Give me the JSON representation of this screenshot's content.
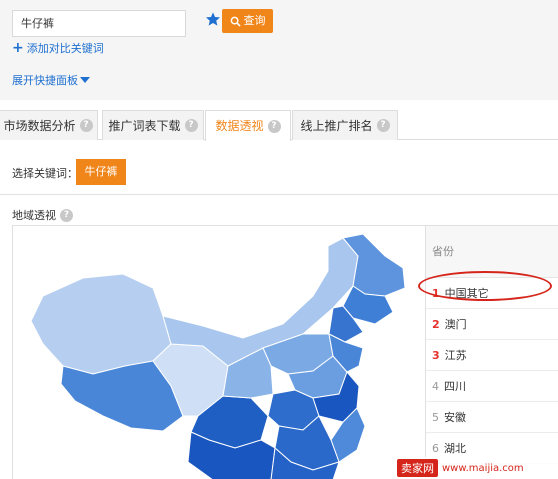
{
  "search": {
    "value": "牛仔裤"
  },
  "toolbar": {
    "query_label": "查询",
    "add_compare_label": "添加对比关键词",
    "expand_panel_label": "展开快捷面板"
  },
  "tabs": [
    {
      "label": "市场数据分析"
    },
    {
      "label": "推广词表下载"
    },
    {
      "label": "数据透视",
      "active": true
    },
    {
      "label": "线上推广排名"
    }
  ],
  "keyword_select": {
    "label": "选择关键词：",
    "chip": "牛仔裤"
  },
  "section": {
    "title": "地域透视"
  },
  "province_table": {
    "header": "省份",
    "rows": [
      {
        "rank": "1",
        "name": "中国其它"
      },
      {
        "rank": "2",
        "name": "澳门"
      },
      {
        "rank": "3",
        "name": "江苏"
      },
      {
        "rank": "4",
        "name": "四川"
      },
      {
        "rank": "5",
        "name": "安徽"
      },
      {
        "rank": "6",
        "name": "湖北"
      }
    ]
  },
  "watermark": {
    "logo": "卖家网",
    "url": "www.maijia.com"
  },
  "colors": {
    "accent": "#f08519",
    "link": "#1e6fd0",
    "highlight": "#d5251b"
  },
  "icons": [
    "star-icon",
    "search-icon",
    "plus-icon",
    "triangle-down-icon",
    "help-icon"
  ]
}
